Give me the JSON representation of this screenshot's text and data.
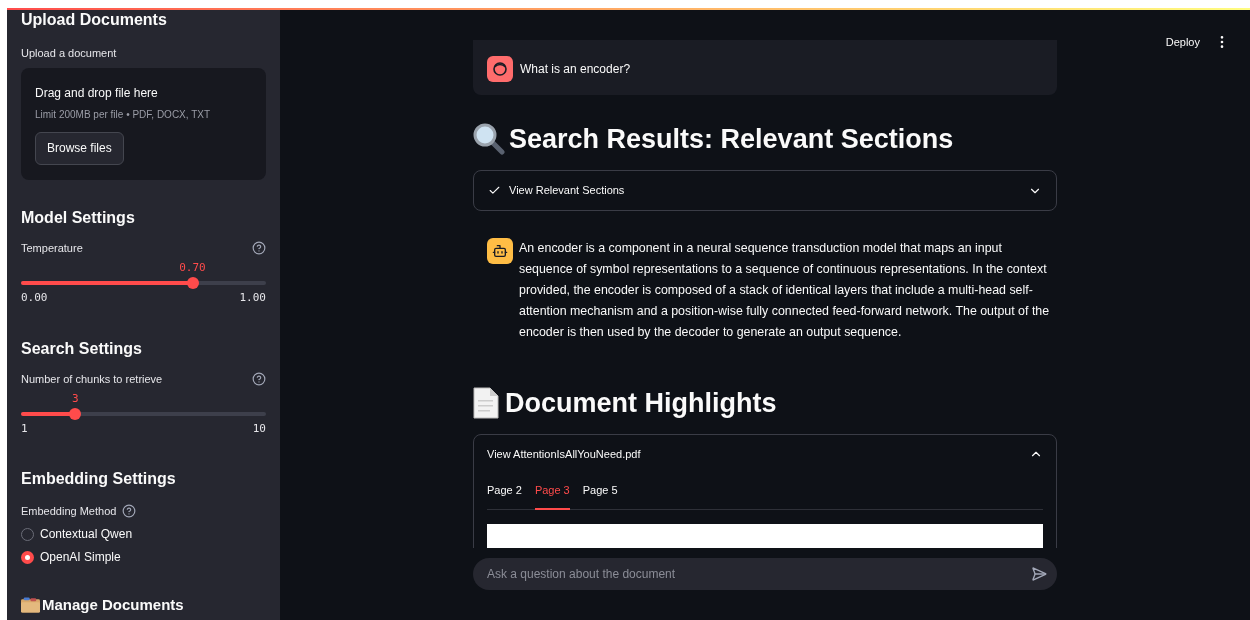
{
  "sidebar": {
    "upload": {
      "heading": "Upload Documents",
      "label": "Upload a document",
      "dropzone_title": "Drag and drop file here",
      "dropzone_hint": "Limit 200MB per file • PDF, DOCX, TXT",
      "button": "Browse files"
    },
    "model_settings": {
      "heading": "Model Settings",
      "slider": {
        "label": "Temperature",
        "value": "0.70",
        "min": "0.00",
        "max": "1.00",
        "level": 0.7
      }
    },
    "search_settings": {
      "heading": "Search Settings",
      "slider": {
        "label": "Number of chunks to retrieve",
        "value": "3",
        "min": "1",
        "max": "10",
        "level": 0.222
      }
    },
    "embedding_settings": {
      "heading": "Embedding Settings",
      "label": "Embedding Method",
      "options": [
        {
          "label": "Contextual Qwen",
          "selected": false
        },
        {
          "label": "OpenAI Simple",
          "selected": true
        }
      ]
    },
    "manage_heading": "Manage Documents"
  },
  "header": {
    "deploy": "Deploy"
  },
  "chat": {
    "user_message": "What is an encoder?",
    "search_heading": "Search Results: Relevant Sections",
    "relevant_expander": {
      "label": "View Relevant Sections",
      "expanded": false
    },
    "assistant_message": "An encoder is a component in a neural sequence transduction model that maps an input sequence of symbol representations to a sequence of continuous representations. In the context provided, the encoder is composed of a stack of identical layers that include a multi-head self-attention mechanism and a position-wise fully connected feed-forward network. The output of the encoder is then used by the decoder to generate an output sequence.",
    "highlights_heading": "Document Highlights",
    "document_expander": {
      "label": "View AttentionIsAllYouNeed.pdf",
      "expanded": true,
      "tabs": [
        {
          "label": "Page 2",
          "selected": false
        },
        {
          "label": "Page 3",
          "selected": true
        },
        {
          "label": "Page 5",
          "selected": false
        }
      ]
    },
    "input": {
      "placeholder": "Ask a question about the document"
    }
  }
}
